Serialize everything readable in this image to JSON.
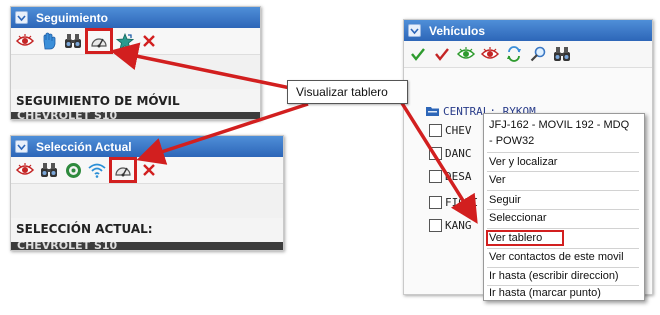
{
  "panel_seguimiento": {
    "title": "Seguimiento",
    "section_title": "SEGUIMIENTO DE MÓVIL",
    "row_text": "CHEVROLET      S10",
    "tools": [
      "eye-icon",
      "hand-icon",
      "binoculars-icon",
      "gauge-icon",
      "star-icon",
      "close-icon"
    ]
  },
  "panel_seleccion": {
    "title": "Selección Actual",
    "section_title": "SELECCIÓN ACTUAL:",
    "row_text": "CHEVROLET      S10",
    "tools": [
      "eye-icon",
      "binoculars-icon",
      "target-icon",
      "wifi-icon",
      "gauge-icon",
      "close-icon"
    ]
  },
  "panel_vehiculos": {
    "title": "Vehículos",
    "tools": [
      "check-green-icon",
      "check-red-icon",
      "eye-green-icon",
      "eye-icon",
      "refresh-icon",
      "search-icon",
      "binoculars-icon"
    ],
    "tree_root": "CENTRAL: RYKOM",
    "tree_items": [
      "CHEV",
      "DANC",
      "DESA",
      "FIORI",
      "KANG"
    ]
  },
  "callout": {
    "label": "Visualizar tablero"
  },
  "context_menu": {
    "header_line1": "JFJ-162 - MOVIL 192 - MDQ",
    "header_line2": "- POW32",
    "items": [
      "Ver y localizar",
      "Ver",
      "Seguir",
      "Seleccionar",
      "Ver tablero",
      "Ver contactos de este movil",
      "Ir hasta (escribir direccion)",
      "Ir hasta (marcar punto)"
    ],
    "highlighted_item": "Ver tablero"
  },
  "colors": {
    "title_bar": "#3a78c9",
    "highlight": "#d21f1f",
    "dark_row": "#3c3c3c",
    "accent_green": "#2e9b2e"
  }
}
